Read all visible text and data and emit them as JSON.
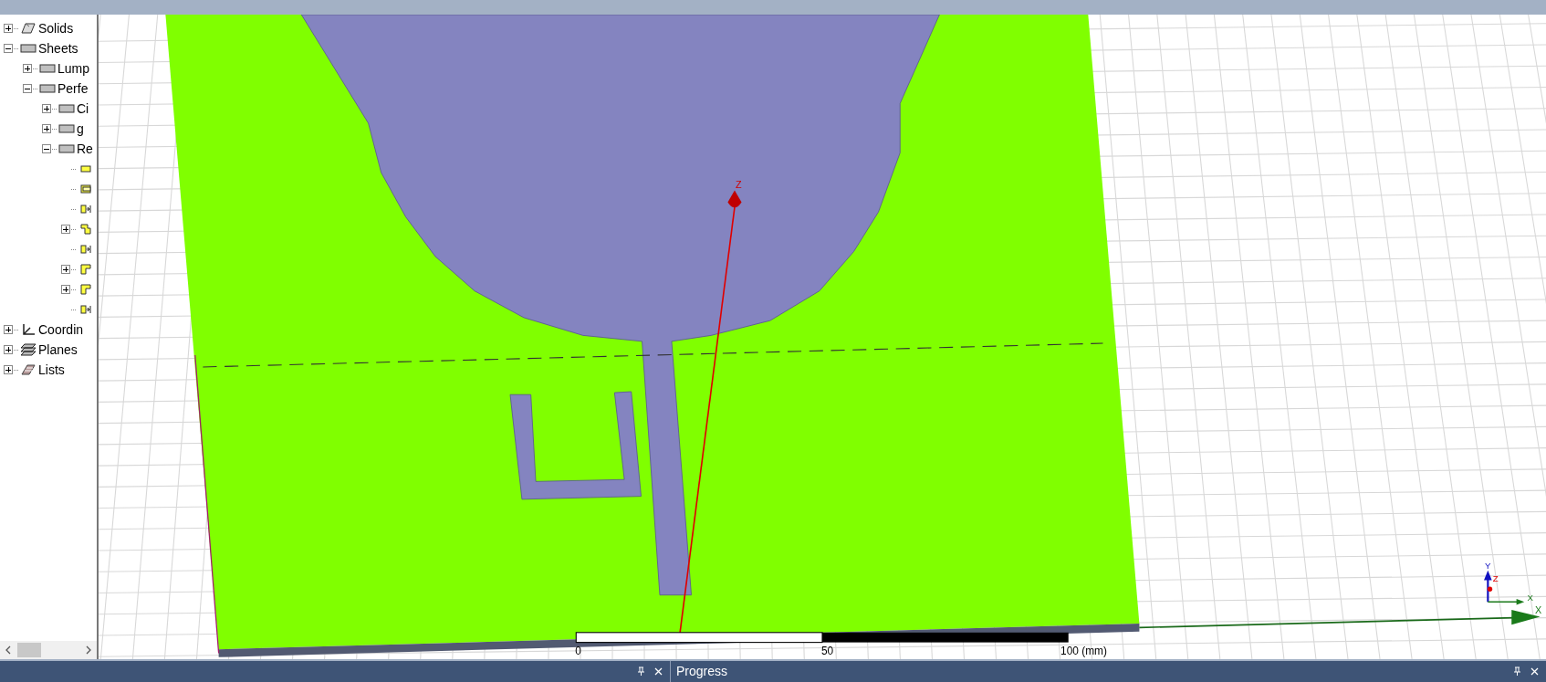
{
  "tree": [
    {
      "label": "Solids",
      "kind": "solid",
      "expanded": false
    },
    {
      "label": "Sheets",
      "kind": "sheet",
      "expanded": true,
      "children": [
        {
          "label": "Lump",
          "kind": "sheet",
          "expanded": false
        },
        {
          "label": "Perfe",
          "kind": "sheet",
          "expanded": true,
          "children": [
            {
              "label": "Ci",
              "kind": "sheet",
              "expanded": false
            },
            {
              "label": "g",
              "kind": "sheet",
              "expanded": false
            },
            {
              "label": "Re",
              "kind": "sheet",
              "expanded": true,
              "children": [
                {
                  "kind": "face"
                },
                {
                  "kind": "face-outline"
                },
                {
                  "kind": "port"
                },
                {
                  "kind": "step",
                  "expanded": false
                },
                {
                  "kind": "port"
                },
                {
                  "kind": "corner",
                  "expanded": false
                },
                {
                  "kind": "corner",
                  "expanded": false
                },
                {
                  "kind": "port"
                }
              ]
            }
          ]
        }
      ]
    },
    {
      "label": "Coordin",
      "kind": "coordinate",
      "expanded": false
    },
    {
      "label": "Planes",
      "kind": "planes",
      "expanded": false
    },
    {
      "label": "Lists",
      "kind": "lists",
      "expanded": false
    }
  ],
  "viewport": {
    "z_axis_label": "Z",
    "x_axis_label": "X",
    "triad": {
      "y": "Y",
      "z": "Z",
      "x": "X"
    },
    "scale_bar": {
      "labels": [
        "0",
        "50",
        "100 (mm)"
      ]
    }
  },
  "bottom_panel": {
    "tab": "Progress"
  }
}
